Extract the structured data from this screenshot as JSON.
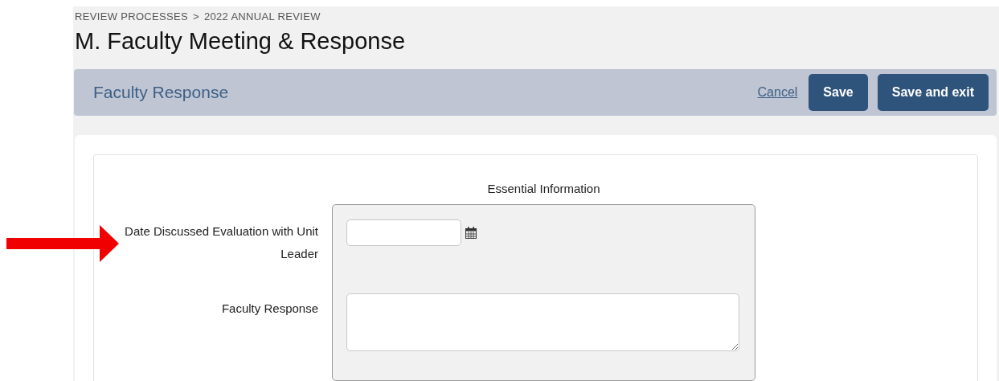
{
  "breadcrumb": {
    "items": [
      "REVIEW PROCESSES",
      "2022 ANNUAL REVIEW"
    ],
    "separator": ">"
  },
  "title": "M. Faculty Meeting & Response",
  "header": {
    "title": "Faculty Response",
    "cancel": "Cancel",
    "buttons": [
      "Save",
      "Save and exit"
    ]
  },
  "section": {
    "title": "Essential Information",
    "fields": [
      {
        "label": "Date Discussed Evaluation with Unit Leader",
        "kind": "date"
      },
      {
        "label": "Faculty Response",
        "kind": "textarea"
      }
    ]
  }
}
